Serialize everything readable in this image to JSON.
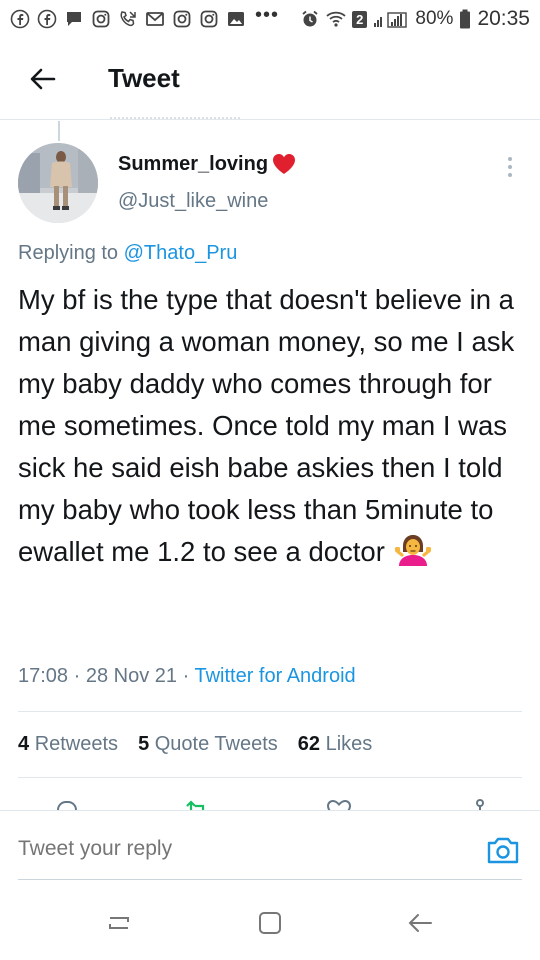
{
  "status_bar": {
    "notification_icons": [
      "facebook-icon",
      "facebook-icon",
      "chat-icon",
      "instagram-icon",
      "missed-call-icon",
      "gmail-icon",
      "instagram-icon",
      "instagram-icon",
      "image-icon",
      "more-dots-icon"
    ],
    "more_dots": "•••",
    "sim_badge": "2",
    "battery_percent": "80%",
    "time": "20:35"
  },
  "header": {
    "title": "Tweet",
    "back_icon": "arrow-left-icon"
  },
  "tweet": {
    "author_name": "Summer_loving",
    "author_name_emoji": "heart-icon",
    "author_handle": "@Just_like_wine",
    "replying_prefix": "Replying to",
    "replying_to": "@Thato_Pru",
    "text": "My bf is the type that doesn't believe in a man giving a woman money, so me I ask my baby daddy who comes through for me sometimes. Once told my man I was sick he said eish babe askies then I told my baby who took less than 5minute to ewallet me 1.2 to see a doctor",
    "text_emoji": "person-shrugging-icon",
    "time": "17:08",
    "separator": "·",
    "date": "28 Nov 21",
    "source": "Twitter for Android"
  },
  "stats": {
    "retweets_count": "4",
    "retweets_label": "Retweets",
    "quotes_count": "5",
    "quotes_label": "Quote Tweets",
    "likes_count": "62",
    "likes_label": "Likes"
  },
  "reply": {
    "placeholder": "Tweet your reply"
  },
  "colors": {
    "link": "#1b95e0",
    "muted": "#657786",
    "divider": "#e1e8ed",
    "text": "#14171a",
    "heart": "#e0202e"
  }
}
